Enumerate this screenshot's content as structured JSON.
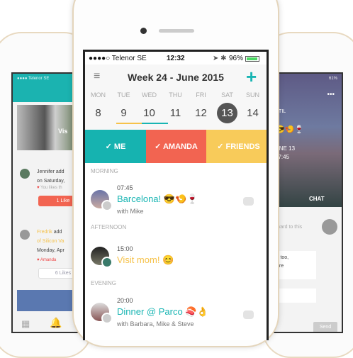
{
  "status": {
    "carrier": "●●●●○ Telenor SE",
    "time": "12:32",
    "battery": "96%"
  },
  "header": {
    "title": "Week 24 - June 2015",
    "add": "+"
  },
  "days": [
    {
      "name": "MON",
      "num": "8"
    },
    {
      "name": "TUE",
      "num": "9"
    },
    {
      "name": "WED",
      "num": "10"
    },
    {
      "name": "THU",
      "num": "11"
    },
    {
      "name": "FRI",
      "num": "12"
    },
    {
      "name": "SAT",
      "num": "13"
    },
    {
      "name": "SUN",
      "num": "14"
    }
  ],
  "filters": [
    {
      "label": "✓ ME",
      "color": "#16b3b0"
    },
    {
      "label": "✓ AMANDA",
      "color": "#f26451"
    },
    {
      "label": "✓ FRIENDS",
      "color": "#f8cb5a"
    }
  ],
  "sections": [
    "MORNING",
    "AFTERNOON",
    "EVENING"
  ],
  "events": [
    {
      "time": "07:45",
      "title": "Barcelona! 😎🍤🍷",
      "with": "with Mike",
      "color": "#19b5b3"
    },
    {
      "time": "15:00",
      "title": "Visit mom! 😊",
      "with": "",
      "color": "#f6c24a"
    },
    {
      "time": "20:00",
      "title": "Dinner @ Parco 🍣👌",
      "with": "with Barbara, Mike & Steve",
      "color": "#19b5b3"
    }
  ],
  "left": {
    "carrier": "●●●● Telenor SE",
    "card1": "Jennifer add",
    "card1b": "on Saturday,",
    "like1": "You likes th",
    "btn1": "1 Like",
    "card2a": "Fredrik",
    "card2b": " add",
    "card2c": "of Silicon Va",
    "card2d": "Monday, Apr",
    "like2": "Amanda",
    "btn2": "6 Likes",
    "overlay": "Vis"
  },
  "right": {
    "battery": "61%",
    "dots": "•••",
    "until": "NTIL",
    "date": "UNE 13",
    "time": "07:45",
    "chat": "CHAT",
    "msg1": "rward to this",
    "msg2": "s too,",
    "msg3": "ere",
    "send": "Send"
  }
}
